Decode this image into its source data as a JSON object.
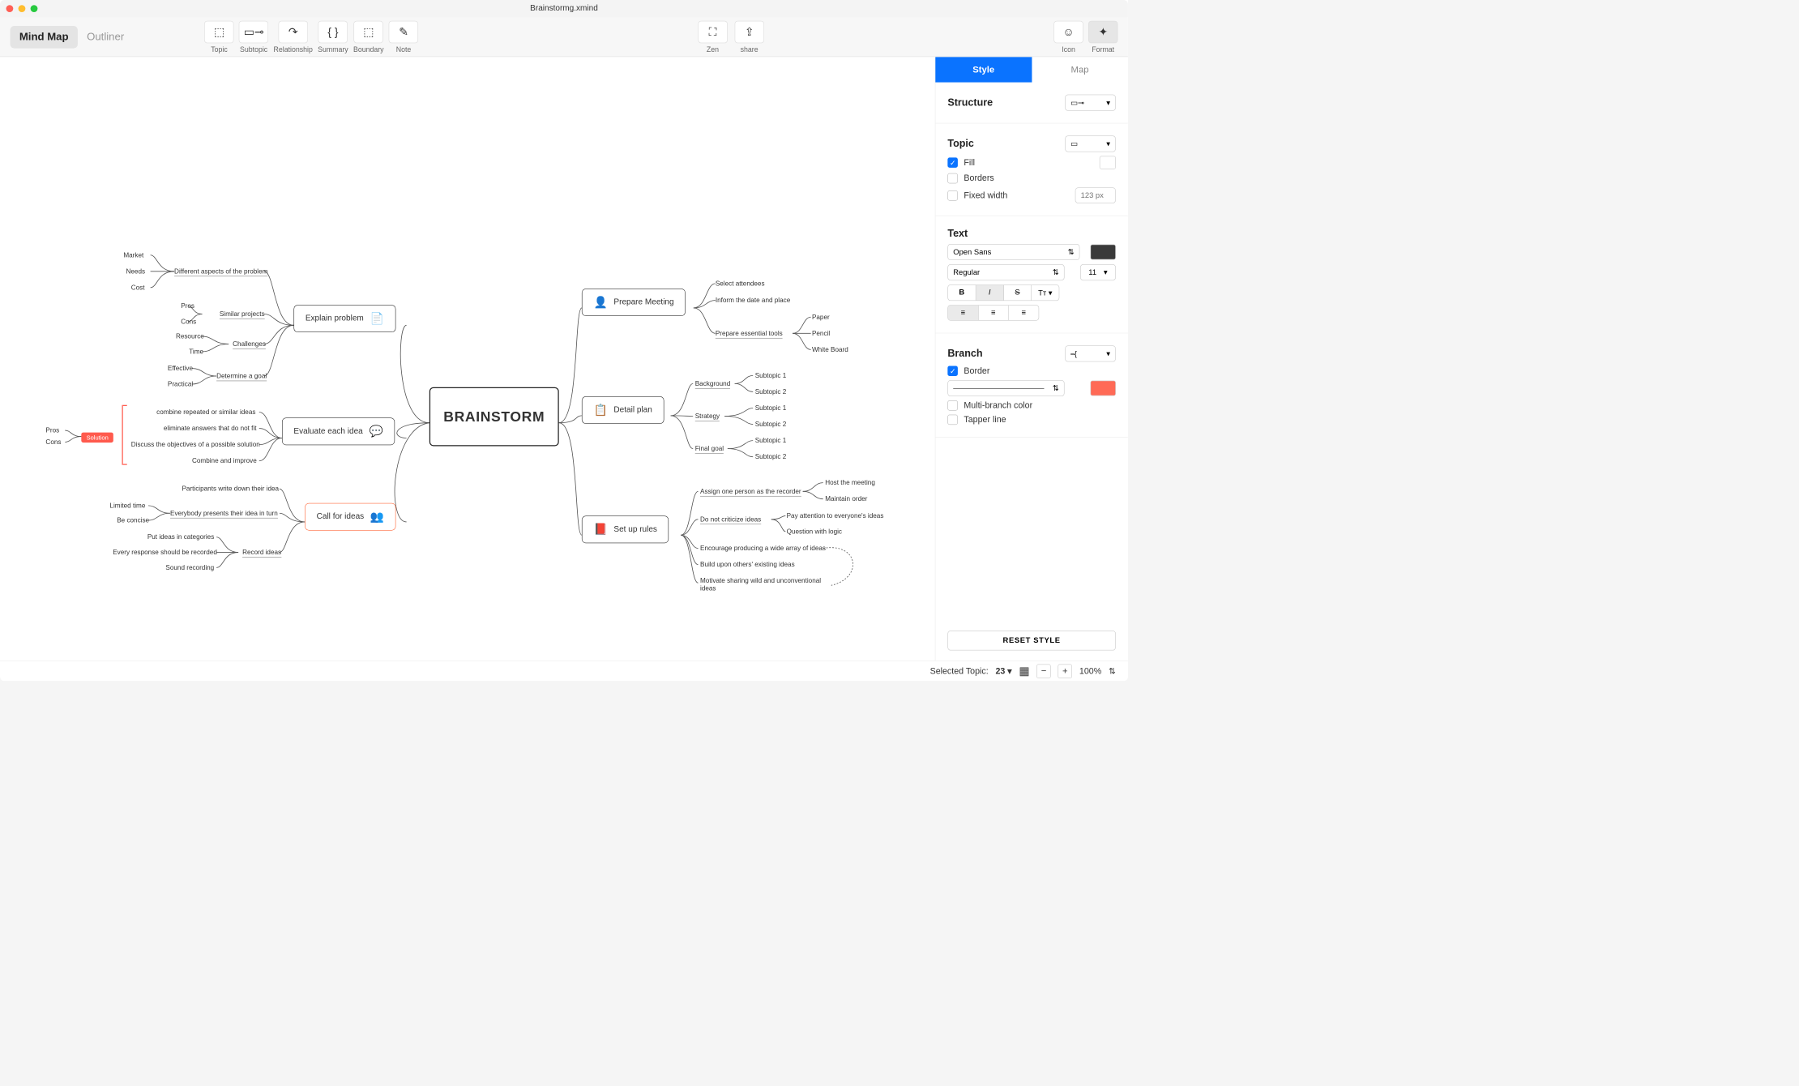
{
  "window": {
    "title": "Brainstormg.xmind"
  },
  "viewTabs": {
    "mindmap": "Mind Map",
    "outliner": "Outliner"
  },
  "toolbar": {
    "topic": "Topic",
    "subtopic": "Subtopic",
    "relationship": "Relationship",
    "summary": "Summary",
    "boundary": "Boundary",
    "note": "Note",
    "zen": "Zen",
    "share": "share",
    "icon": "Icon",
    "format": "Format"
  },
  "map": {
    "central": "BRAINSTORM",
    "left": {
      "explain": {
        "label": "Explain problem",
        "aspects": {
          "label": "Different aspects of the problem",
          "items": [
            "Market",
            "Needs",
            "Cost"
          ]
        },
        "similar": {
          "label": "Similar projects",
          "items": [
            "Pros",
            "Cons"
          ]
        },
        "challenges": {
          "label": "Challenges",
          "items": [
            "Resource",
            "Time"
          ]
        },
        "goal": {
          "label": "Determine a goal",
          "items": [
            "Effective",
            "Practical"
          ]
        }
      },
      "evaluate": {
        "label": "Evaluate each idea",
        "items": [
          "combine repeated or similar ideas",
          "eliminate answers that do not fit",
          "Discuss the objectives of a possible solution",
          "Combine and improve"
        ],
        "solution": {
          "label": "Solution",
          "items": [
            "Pros",
            "Cons"
          ]
        }
      },
      "call": {
        "label": "Call for ideas",
        "writeDown": "Participants write down their idea",
        "present": {
          "label": "Everybody presents their idea in turn",
          "items": [
            "Limited time",
            "Be concise"
          ]
        },
        "record": {
          "label": "Record ideas",
          "items": [
            "Put ideas in categories",
            "Every response should be recorded",
            "Sound recording"
          ]
        }
      }
    },
    "right": {
      "prepare": {
        "label": "Prepare Meeting",
        "items": [
          "Select attendees",
          "Inform the date and place"
        ],
        "tools": {
          "label": "Prepare essential tools",
          "items": [
            "Paper",
            "Pencil",
            "White Board"
          ]
        }
      },
      "detail": {
        "label": "Detail plan",
        "groups": [
          {
            "label": "Background",
            "items": [
              "Subtopic 1",
              "Subtopic 2"
            ]
          },
          {
            "label": "Strategy",
            "items": [
              "Subtopic 1",
              "Subtopic 2"
            ]
          },
          {
            "label": "Final goal",
            "items": [
              "Subtopic 1",
              "Subtopic 2"
            ]
          }
        ]
      },
      "rules": {
        "label": "Set up rules",
        "recorder": {
          "label": "Assign one person as the recorder",
          "items": [
            "Host the meeting",
            "Maintain order"
          ]
        },
        "criticize": {
          "label": "Do not criticize ideas",
          "items": [
            "Pay attention to everyone's ideas",
            "Question with logic"
          ]
        },
        "others": [
          "Encourage producing a wide array of ideas",
          "Build upon others' existing ideas",
          "Motivate sharing wild and unconventional ideas"
        ]
      }
    }
  },
  "panel": {
    "tabs": {
      "style": "Style",
      "map": "Map"
    },
    "structure": {
      "label": "Structure"
    },
    "topic": {
      "label": "Topic",
      "fill": "Fill",
      "borders": "Borders",
      "fixedWidth": "Fixed width",
      "widthPlaceholder": "123 px"
    },
    "text": {
      "label": "Text",
      "font": "Open Sans",
      "weight": "Regular",
      "size": "11"
    },
    "branch": {
      "label": "Branch",
      "border": "Border",
      "multi": "Multi-branch color",
      "tapper": "Tapper line",
      "borderColor": "#ff6a56"
    },
    "reset": "RESET STYLE"
  },
  "status": {
    "selectedLabel": "Selected Topic:",
    "selectedCount": "23",
    "zoom": "100%"
  }
}
